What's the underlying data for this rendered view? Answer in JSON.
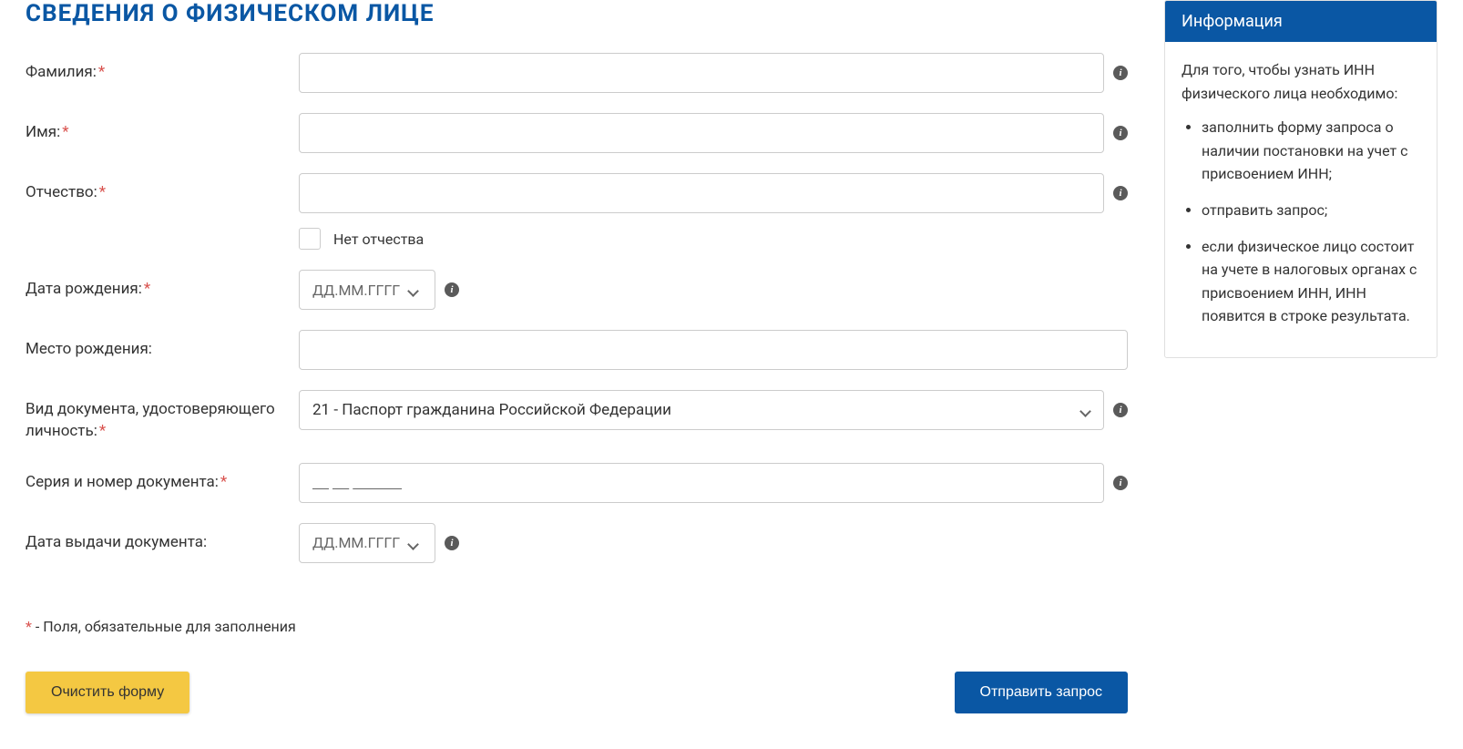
{
  "title": "СВЕДЕНИЯ О ФИЗИЧЕСКОМ ЛИЦЕ",
  "form": {
    "surname": {
      "label": "Фамилия:",
      "required": true
    },
    "name": {
      "label": "Имя:",
      "required": true
    },
    "patronymic": {
      "label": "Отчество:",
      "required": true
    },
    "no_patronymic": {
      "label": "Нет отчества"
    },
    "dob": {
      "label": "Дата рождения:",
      "required": true,
      "placeholder": "ДД.ММ.ГГГГ"
    },
    "pob": {
      "label": "Место рождения:"
    },
    "doc_type": {
      "label": "Вид документа, удостоверяющего личность:",
      "required": true,
      "value": "21 - Паспорт гражданина Российской Федерации"
    },
    "doc_number": {
      "label": "Серия и номер документа:",
      "required": true,
      "placeholder": "__ __ ______"
    },
    "doc_date": {
      "label": "Дата выдачи документа:",
      "placeholder": "ДД.ММ.ГГГГ"
    }
  },
  "required_note": {
    "star": "*",
    "text": " - Поля, обязательные для заполнения"
  },
  "buttons": {
    "clear": "Очистить форму",
    "submit": "Отправить запрос"
  },
  "sidebar": {
    "title": "Информация",
    "intro": "Для того, чтобы узнать ИНН физического лица необходимо:",
    "items": [
      "заполнить форму запроса о наличии постановки на учет с присвоением ИНН;",
      "отправить запрос;",
      "если физическое лицо состоит на учете в налоговых органах с присвоением ИНН, ИНН появится в строке результата."
    ]
  }
}
